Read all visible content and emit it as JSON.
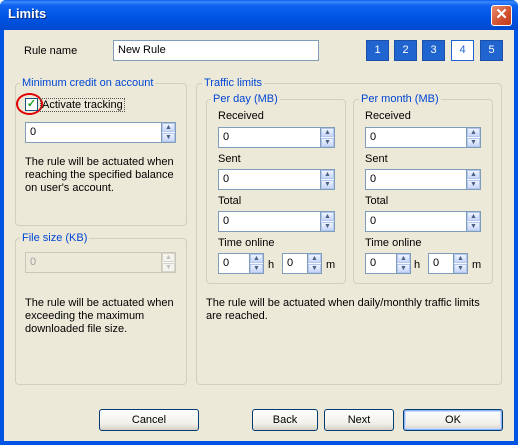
{
  "window": {
    "title": "Limits",
    "close_glyph": "✕"
  },
  "rule": {
    "label": "Rule name",
    "value": "New Rule"
  },
  "pages": {
    "p1": "1",
    "p2": "2",
    "p3": "3",
    "p4": "4",
    "p5": "5",
    "active": "4"
  },
  "credit": {
    "legend": "Minimum credit on account",
    "checkbox_label": "Activate tracking",
    "checked": true,
    "value": "0",
    "desc": [
      "The rule will be actuated when",
      "reaching the specified balance",
      "on user's account."
    ]
  },
  "filesize": {
    "legend": "File size (KB)",
    "value": "0",
    "desc": [
      "The rule will be actuated when",
      "exceeding the maximum",
      "downloaded file size."
    ]
  },
  "traffic": {
    "legend": "Traffic limits",
    "per_day": {
      "legend": "Per day (MB)",
      "received_label": "Received",
      "received": "0",
      "sent_label": "Sent",
      "sent": "0",
      "total_label": "Total",
      "total": "0",
      "time_label": "Time online",
      "hours": "0",
      "h": "h",
      "minutes": "0",
      "m": "m"
    },
    "per_month": {
      "legend": "Per month (MB)",
      "received_label": "Received",
      "received": "0",
      "sent_label": "Sent",
      "sent": "0",
      "total_label": "Total",
      "total": "0",
      "time_label": "Time online",
      "hours": "0",
      "h": "h",
      "minutes": "0",
      "m": "m"
    },
    "desc": [
      "The rule will be actuated when daily/monthly traffic limits",
      "are reached."
    ]
  },
  "buttons": {
    "cancel": "Cancel",
    "back": "Back",
    "next": "Next",
    "ok": "OK"
  },
  "glyphs": {
    "up": "▲",
    "down": "▼",
    "check": "✓"
  },
  "colors": {
    "title_bar": "#0054e3",
    "page_button": "#2064cf",
    "legend_text": "#0046d5",
    "highlight_circle": "#e00000"
  }
}
